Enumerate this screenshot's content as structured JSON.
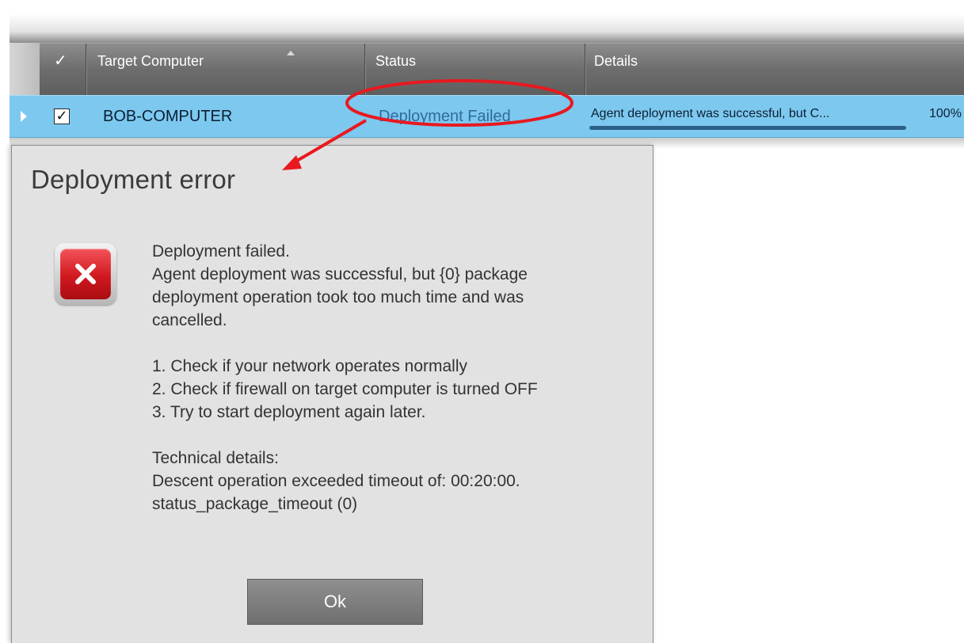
{
  "grid": {
    "columns": {
      "check": "✓",
      "target": "Target Computer",
      "status": "Status",
      "details": "Details"
    },
    "row": {
      "checked": "✓",
      "target": "BOB-COMPUTER",
      "status": "Deployment Failed",
      "details": "Agent deployment was successful, but C...",
      "percent": "100%",
      "progress_fraction": 1.0
    }
  },
  "dialog": {
    "title": "Deployment error",
    "icon": "error-x-icon",
    "lines": [
      "Deployment failed.",
      "Agent deployment was successful, but {0} package",
      "deployment operation took too much time and was",
      "cancelled.",
      "1. Check if your network operates normally",
      "2. Check if firewall on target computer is turned OFF",
      "3. Try to start deployment again later.",
      "Technical details:",
      "Descent operation exceeded timeout of: 00:20:00.",
      "status_package_timeout (0)"
    ],
    "ok_label": "Ok"
  },
  "colors": {
    "row_highlight": "#7dc8ef",
    "annotation": "#e8191f",
    "header_bg": "#6d6d6d",
    "dialog_bg": "#e2e2e2"
  }
}
